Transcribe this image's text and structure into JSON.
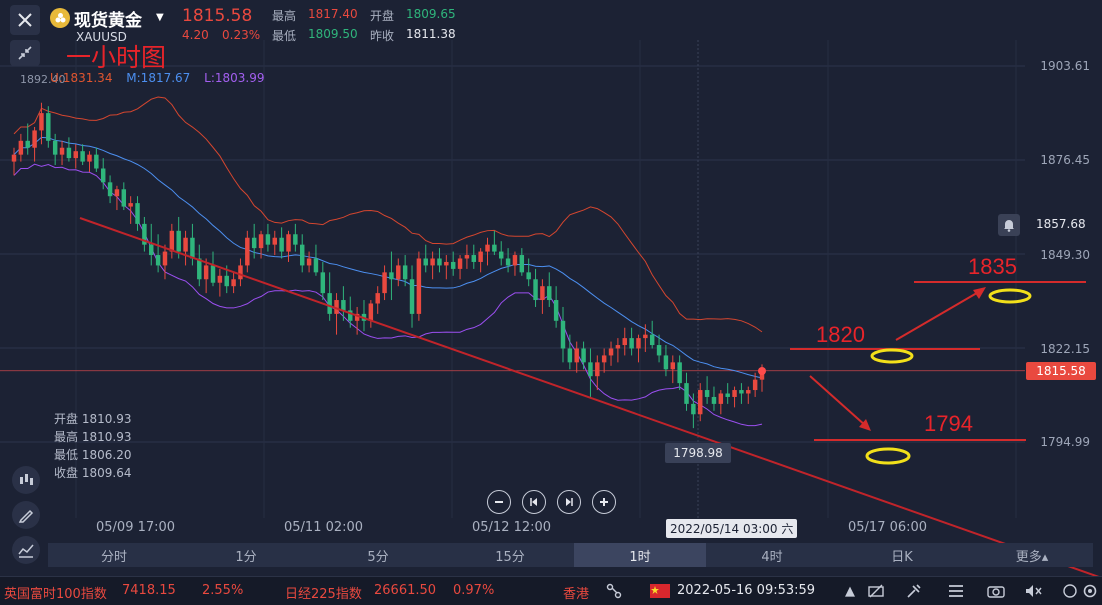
{
  "header": {
    "symbol_name": "现货黄金",
    "symbol_code": "XAUUSD",
    "last_price": "1815.58",
    "change_abs": "4.20",
    "change_pct": "0.23%",
    "high_label": "最高",
    "high_value": "1817.40",
    "open_label": "开盘",
    "open_value": "1809.65",
    "low_label": "最低",
    "low_value": "1809.50",
    "prev_close_label": "昨收",
    "prev_close_value": "1811.38"
  },
  "annotation_title": "一小时图",
  "bollinger_legend": {
    "upper": "U:1831.34",
    "middle": "M:1817.67",
    "lower": "L:1803.99"
  },
  "left_top_value": "1892.40",
  "ohlc_panel": [
    {
      "label": "开盘",
      "value": "1810.93"
    },
    {
      "label": "最高",
      "value": "1810.93"
    },
    {
      "label": "最低",
      "value": "1806.20"
    },
    {
      "label": "收盘",
      "value": "1809.64"
    }
  ],
  "y_axis": {
    "labels": [
      "1903.61",
      "1876.45",
      "1849.30",
      "1822.15",
      "1794.99"
    ],
    "alert_value": "1857.68",
    "current_price_tag": "1815.58",
    "visible_low_tag": "1798.98"
  },
  "x_axis": {
    "labels": [
      "05/09 17:00",
      "05/11 02:00",
      "05/12 12:00",
      "05/17 06:00"
    ],
    "hover_label": "2022/05/14 03:00 六"
  },
  "timeframes": [
    {
      "label": "分时",
      "active": false
    },
    {
      "label": "1分",
      "active": false
    },
    {
      "label": "5分",
      "active": false
    },
    {
      "label": "15分",
      "active": false
    },
    {
      "label": "1时",
      "active": true
    },
    {
      "label": "4时",
      "active": false
    },
    {
      "label": "日K",
      "active": false
    },
    {
      "label": "更多▴",
      "active": false
    }
  ],
  "annotations": {
    "target_up_1": "1820",
    "target_up_2": "1835",
    "target_down": "1794"
  },
  "bottom_bar": {
    "ticker1_name": "英国富时100指数",
    "ticker1_value": "7418.15",
    "ticker1_change": "2.55%",
    "ticker2_name": "日经225指数",
    "ticker2_value": "26661.50",
    "ticker2_change": "0.97%",
    "ticker3_name": "香港",
    "datetime": "2022-05-16 09:53:59"
  },
  "colors": {
    "background": "#1c2234",
    "up": "#e9493f",
    "down": "#2fb57c",
    "boll_upper": "#d4462f",
    "boll_middle": "#4c8ff0",
    "boll_lower": "#9b4ff0",
    "annotation_red": "#e8242a",
    "annotation_yellow": "#f2e01a"
  },
  "chart_data": {
    "type": "candlestick",
    "title": "",
    "y_axis_ticks": [
      1903.61,
      1876.45,
      1849.3,
      1822.15,
      1794.99
    ],
    "ylim": [
      1786,
      1910
    ],
    "x_ticks": [
      "05/09 17:00",
      "05/11 02:00",
      "05/12 12:00",
      "05/17 06:00"
    ],
    "grid": true,
    "candles": [
      {
        "o": 1876,
        "h": 1880,
        "l": 1872,
        "c": 1878
      },
      {
        "o": 1878,
        "h": 1884,
        "l": 1876,
        "c": 1882
      },
      {
        "o": 1882,
        "h": 1887,
        "l": 1878,
        "c": 1880
      },
      {
        "o": 1880,
        "h": 1886,
        "l": 1876,
        "c": 1885
      },
      {
        "o": 1885,
        "h": 1893,
        "l": 1881,
        "c": 1890
      },
      {
        "o": 1890,
        "h": 1892,
        "l": 1880,
        "c": 1882
      },
      {
        "o": 1882,
        "h": 1884,
        "l": 1875,
        "c": 1878
      },
      {
        "o": 1878,
        "h": 1882,
        "l": 1875,
        "c": 1880
      },
      {
        "o": 1880,
        "h": 1883,
        "l": 1876,
        "c": 1877
      },
      {
        "o": 1877,
        "h": 1881,
        "l": 1874,
        "c": 1879
      },
      {
        "o": 1879,
        "h": 1881,
        "l": 1875,
        "c": 1876
      },
      {
        "o": 1876,
        "h": 1879,
        "l": 1873,
        "c": 1878
      },
      {
        "o": 1878,
        "h": 1880,
        "l": 1873,
        "c": 1874
      },
      {
        "o": 1874,
        "h": 1877,
        "l": 1868,
        "c": 1870
      },
      {
        "o": 1870,
        "h": 1872,
        "l": 1864,
        "c": 1866
      },
      {
        "o": 1866,
        "h": 1869,
        "l": 1862,
        "c": 1868
      },
      {
        "o": 1868,
        "h": 1870,
        "l": 1862,
        "c": 1863
      },
      {
        "o": 1863,
        "h": 1866,
        "l": 1858,
        "c": 1864
      },
      {
        "o": 1864,
        "h": 1866,
        "l": 1856,
        "c": 1858
      },
      {
        "o": 1858,
        "h": 1860,
        "l": 1850,
        "c": 1852
      },
      {
        "o": 1852,
        "h": 1858,
        "l": 1846,
        "c": 1849
      },
      {
        "o": 1849,
        "h": 1855,
        "l": 1844,
        "c": 1846
      },
      {
        "o": 1846,
        "h": 1852,
        "l": 1842,
        "c": 1850
      },
      {
        "o": 1850,
        "h": 1858,
        "l": 1848,
        "c": 1856
      },
      {
        "o": 1856,
        "h": 1860,
        "l": 1848,
        "c": 1850
      },
      {
        "o": 1850,
        "h": 1856,
        "l": 1846,
        "c": 1854
      },
      {
        "o": 1854,
        "h": 1858,
        "l": 1846,
        "c": 1848
      },
      {
        "o": 1848,
        "h": 1852,
        "l": 1840,
        "c": 1842
      },
      {
        "o": 1842,
        "h": 1848,
        "l": 1838,
        "c": 1846
      },
      {
        "o": 1846,
        "h": 1850,
        "l": 1840,
        "c": 1841
      },
      {
        "o": 1841,
        "h": 1845,
        "l": 1837,
        "c": 1843
      },
      {
        "o": 1843,
        "h": 1846,
        "l": 1838,
        "c": 1840
      },
      {
        "o": 1840,
        "h": 1844,
        "l": 1838,
        "c": 1842
      },
      {
        "o": 1842,
        "h": 1848,
        "l": 1840,
        "c": 1846
      },
      {
        "o": 1846,
        "h": 1856,
        "l": 1844,
        "c": 1854
      },
      {
        "o": 1854,
        "h": 1858,
        "l": 1848,
        "c": 1851
      },
      {
        "o": 1851,
        "h": 1856,
        "l": 1848,
        "c": 1855
      },
      {
        "o": 1855,
        "h": 1858,
        "l": 1850,
        "c": 1852
      },
      {
        "o": 1852,
        "h": 1856,
        "l": 1849,
        "c": 1854
      },
      {
        "o": 1854,
        "h": 1857,
        "l": 1848,
        "c": 1850
      },
      {
        "o": 1850,
        "h": 1856,
        "l": 1847,
        "c": 1855
      },
      {
        "o": 1855,
        "h": 1858,
        "l": 1850,
        "c": 1852
      },
      {
        "o": 1852,
        "h": 1855,
        "l": 1844,
        "c": 1846
      },
      {
        "o": 1846,
        "h": 1850,
        "l": 1844,
        "c": 1848
      },
      {
        "o": 1848,
        "h": 1852,
        "l": 1843,
        "c": 1844
      },
      {
        "o": 1844,
        "h": 1847,
        "l": 1836,
        "c": 1838
      },
      {
        "o": 1838,
        "h": 1844,
        "l": 1830,
        "c": 1832
      },
      {
        "o": 1832,
        "h": 1838,
        "l": 1826,
        "c": 1836
      },
      {
        "o": 1836,
        "h": 1840,
        "l": 1830,
        "c": 1833
      },
      {
        "o": 1833,
        "h": 1837,
        "l": 1828,
        "c": 1830
      },
      {
        "o": 1830,
        "h": 1834,
        "l": 1826,
        "c": 1832
      },
      {
        "o": 1832,
        "h": 1836,
        "l": 1827,
        "c": 1830
      },
      {
        "o": 1830,
        "h": 1836,
        "l": 1828,
        "c": 1835
      },
      {
        "o": 1835,
        "h": 1840,
        "l": 1832,
        "c": 1838
      },
      {
        "o": 1838,
        "h": 1846,
        "l": 1836,
        "c": 1844
      },
      {
        "o": 1844,
        "h": 1850,
        "l": 1836,
        "c": 1842
      },
      {
        "o": 1842,
        "h": 1848,
        "l": 1840,
        "c": 1846
      },
      {
        "o": 1846,
        "h": 1849,
        "l": 1840,
        "c": 1842
      },
      {
        "o": 1842,
        "h": 1846,
        "l": 1828,
        "c": 1832
      },
      {
        "o": 1832,
        "h": 1850,
        "l": 1830,
        "c": 1848
      },
      {
        "o": 1848,
        "h": 1852,
        "l": 1844,
        "c": 1846
      },
      {
        "o": 1846,
        "h": 1850,
        "l": 1842,
        "c": 1848
      },
      {
        "o": 1848,
        "h": 1851,
        "l": 1844,
        "c": 1846
      },
      {
        "o": 1846,
        "h": 1849,
        "l": 1842,
        "c": 1847
      },
      {
        "o": 1847,
        "h": 1850,
        "l": 1843,
        "c": 1845
      },
      {
        "o": 1845,
        "h": 1849,
        "l": 1842,
        "c": 1848
      },
      {
        "o": 1848,
        "h": 1852,
        "l": 1845,
        "c": 1849
      },
      {
        "o": 1849,
        "h": 1852,
        "l": 1845,
        "c": 1847
      },
      {
        "o": 1847,
        "h": 1851,
        "l": 1844,
        "c": 1850
      },
      {
        "o": 1850,
        "h": 1854,
        "l": 1846,
        "c": 1852
      },
      {
        "o": 1852,
        "h": 1856,
        "l": 1849,
        "c": 1850
      },
      {
        "o": 1850,
        "h": 1853,
        "l": 1846,
        "c": 1848
      },
      {
        "o": 1848,
        "h": 1851,
        "l": 1844,
        "c": 1846
      },
      {
        "o": 1846,
        "h": 1850,
        "l": 1843,
        "c": 1849
      },
      {
        "o": 1849,
        "h": 1851,
        "l": 1843,
        "c": 1844
      },
      {
        "o": 1844,
        "h": 1848,
        "l": 1840,
        "c": 1842
      },
      {
        "o": 1842,
        "h": 1845,
        "l": 1834,
        "c": 1836
      },
      {
        "o": 1836,
        "h": 1842,
        "l": 1832,
        "c": 1840
      },
      {
        "o": 1840,
        "h": 1844,
        "l": 1834,
        "c": 1836
      },
      {
        "o": 1836,
        "h": 1840,
        "l": 1828,
        "c": 1830
      },
      {
        "o": 1830,
        "h": 1834,
        "l": 1818,
        "c": 1822
      },
      {
        "o": 1822,
        "h": 1826,
        "l": 1816,
        "c": 1818
      },
      {
        "o": 1818,
        "h": 1824,
        "l": 1815,
        "c": 1822
      },
      {
        "o": 1822,
        "h": 1824,
        "l": 1816,
        "c": 1818
      },
      {
        "o": 1818,
        "h": 1822,
        "l": 1808,
        "c": 1814
      },
      {
        "o": 1814,
        "h": 1820,
        "l": 1810,
        "c": 1818
      },
      {
        "o": 1818,
        "h": 1822,
        "l": 1815,
        "c": 1820
      },
      {
        "o": 1820,
        "h": 1824,
        "l": 1817,
        "c": 1822
      },
      {
        "o": 1822,
        "h": 1825,
        "l": 1818,
        "c": 1823
      },
      {
        "o": 1823,
        "h": 1828,
        "l": 1820,
        "c": 1825
      },
      {
        "o": 1825,
        "h": 1828,
        "l": 1820,
        "c": 1822
      },
      {
        "o": 1822,
        "h": 1826,
        "l": 1818,
        "c": 1825
      },
      {
        "o": 1825,
        "h": 1829,
        "l": 1821,
        "c": 1826
      },
      {
        "o": 1826,
        "h": 1830,
        "l": 1822,
        "c": 1823
      },
      {
        "o": 1823,
        "h": 1826,
        "l": 1818,
        "c": 1820
      },
      {
        "o": 1820,
        "h": 1823,
        "l": 1814,
        "c": 1816
      },
      {
        "o": 1816,
        "h": 1820,
        "l": 1812,
        "c": 1818
      },
      {
        "o": 1818,
        "h": 1820,
        "l": 1810,
        "c": 1812
      },
      {
        "o": 1812,
        "h": 1815,
        "l": 1804,
        "c": 1806
      },
      {
        "o": 1806,
        "h": 1809,
        "l": 1799,
        "c": 1803
      },
      {
        "o": 1803,
        "h": 1812,
        "l": 1801,
        "c": 1810
      },
      {
        "o": 1810,
        "h": 1814,
        "l": 1806,
        "c": 1808
      },
      {
        "o": 1808,
        "h": 1811,
        "l": 1804,
        "c": 1806
      },
      {
        "o": 1806,
        "h": 1810,
        "l": 1803,
        "c": 1809
      },
      {
        "o": 1809,
        "h": 1812,
        "l": 1806,
        "c": 1808
      },
      {
        "o": 1808,
        "h": 1811,
        "l": 1805,
        "c": 1810
      },
      {
        "o": 1810,
        "h": 1812,
        "l": 1806,
        "c": 1809
      },
      {
        "o": 1809,
        "h": 1811,
        "l": 1806,
        "c": 1810
      },
      {
        "o": 1810,
        "h": 1815,
        "l": 1808,
        "c": 1813
      },
      {
        "o": 1813,
        "h": 1817.4,
        "l": 1809.5,
        "c": 1815.58
      }
    ]
  }
}
